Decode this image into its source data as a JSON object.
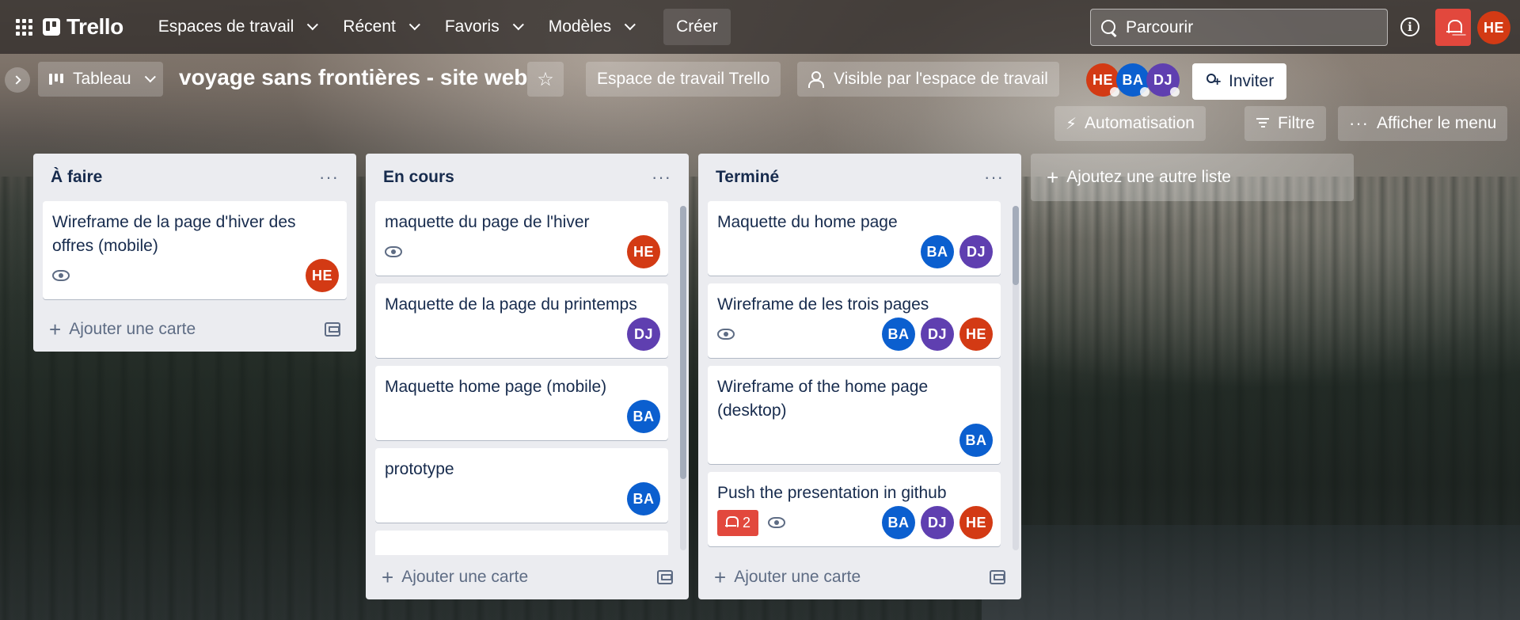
{
  "topnav": {
    "logo": "Trello",
    "items": [
      {
        "label": "Espaces de travail"
      },
      {
        "label": "Récent"
      },
      {
        "label": "Favoris"
      },
      {
        "label": "Modèles"
      }
    ],
    "create_label": "Créer",
    "search_placeholder": "Parcourir",
    "info_label": "i",
    "user_initials": "HE"
  },
  "board": {
    "view_label": "Tableau",
    "title": "voyage sans frontières - site web",
    "workspace_label": "Espace de travail Trello",
    "visibility_label": "Visible par l'espace de travail",
    "members": [
      "HE",
      "BA",
      "DJ"
    ],
    "invite_label": "Inviter",
    "automation_label": "Automatisation",
    "filter_label": "Filtre",
    "menu_label": "Afficher le menu",
    "add_list_label": "Ajoutez une autre liste",
    "add_card_label": "Ajouter une carte"
  },
  "lists": [
    {
      "title": "À faire",
      "cards": [
        {
          "title": "Wireframe de la page d'hiver des offres (mobile)",
          "watch": true,
          "members": [
            "HE"
          ]
        }
      ]
    },
    {
      "title": "En cours",
      "cards": [
        {
          "title": "maquette du page de l'hiver",
          "watch": true,
          "members": [
            "HE"
          ]
        },
        {
          "title": "Maquette de la page du printemps",
          "watch": false,
          "members": [
            "DJ"
          ]
        },
        {
          "title": "Maquette home page (mobile)",
          "watch": false,
          "members": [
            "BA"
          ]
        },
        {
          "title": "prototype",
          "watch": false,
          "members": [
            "BA"
          ]
        }
      ]
    },
    {
      "title": "Terminé",
      "cards": [
        {
          "title": "Maquette du home page",
          "watch": false,
          "members": [
            "BA",
            "DJ"
          ]
        },
        {
          "title": "Wireframe de les trois pages",
          "watch": true,
          "members": [
            "BA",
            "DJ",
            "HE"
          ]
        },
        {
          "title": "Wireframe of the home page (desktop)",
          "watch": false,
          "members": [
            "BA"
          ]
        },
        {
          "title": "Push the presentation in github",
          "watch": true,
          "notifications": "2",
          "members": [
            "BA",
            "DJ",
            "HE"
          ]
        }
      ]
    }
  ],
  "colors": {
    "HE": "#d33a14",
    "BA": "#0b5fcf",
    "DJ": "#5f3fb0",
    "notification": "#e2483d"
  }
}
